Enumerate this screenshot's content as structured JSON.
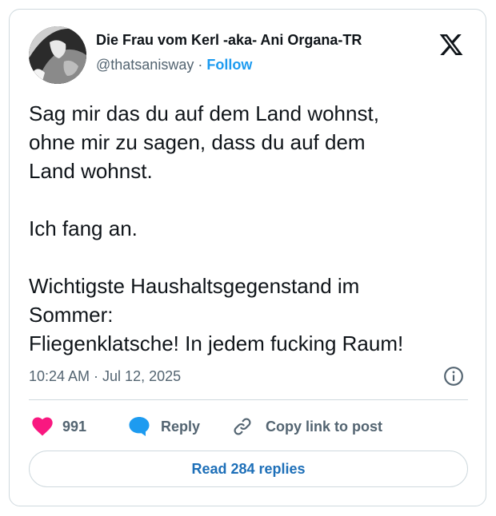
{
  "author": {
    "display_name": "Die Frau vom Kerl -aka- Ani Organa-TR",
    "handle": "@thatsanisway",
    "separator": "·",
    "follow_label": "Follow"
  },
  "tweet": {
    "text": "Sag mir das du auf dem Land wohnst,\nohne mir zu sagen, dass du auf dem\nLand wohnst.\n\nIch fang an.\n\nWichtigste Haushaltsgegenstand im\nSommer:\nFliegenklatsche! In jedem fucking Raum!",
    "timestamp": "10:24 AM · Jul 12, 2025"
  },
  "actions": {
    "like_count": "991",
    "reply_label": "Reply",
    "copy_label": "Copy link to post"
  },
  "read_replies_label": "Read 284 replies",
  "icons": {
    "platform": "x-logo-icon",
    "like": "heart-icon",
    "reply": "speech-bubble-icon",
    "copy": "link-icon",
    "info": "info-icon"
  },
  "colors": {
    "accent": "#1d9bf0",
    "heart": "#f91880",
    "muted": "#536471",
    "text": "#0f1419",
    "border": "#cfd9de"
  }
}
